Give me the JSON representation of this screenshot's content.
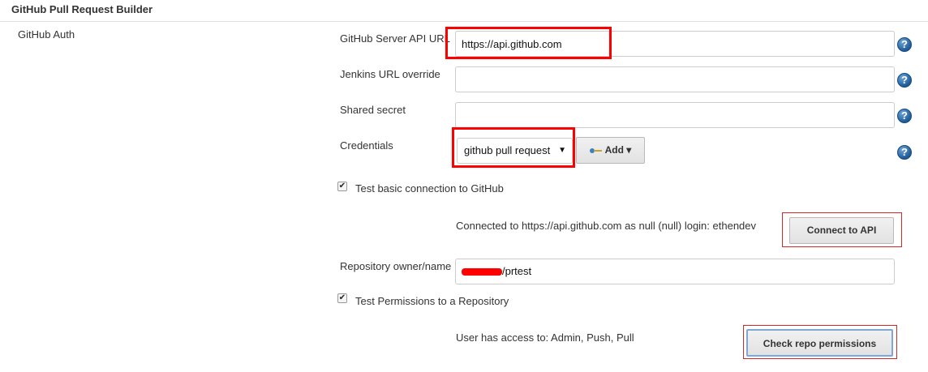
{
  "section": {
    "title": "GitHub Pull Request Builder"
  },
  "group": {
    "label": "GitHub Auth"
  },
  "fields": {
    "server_api_url": {
      "label": "GitHub Server API URL",
      "value": "https://api.github.com"
    },
    "jenkins_url_override": {
      "label": "Jenkins URL override",
      "value": ""
    },
    "shared_secret": {
      "label": "Shared secret",
      "value": ""
    },
    "credentials": {
      "label": "Credentials",
      "selected": "github pull request",
      "add_label": "Add"
    },
    "repo_owner_name": {
      "label": "Repository owner/name",
      "value": "/prtest"
    }
  },
  "test_connection": {
    "checkbox_label": "Test basic connection to GitHub",
    "checked": true,
    "result": "Connected to https://api.github.com as null (null) login: ethendev",
    "button_label": "Connect to API"
  },
  "test_permissions": {
    "checkbox_label": "Test Permissions to a Repository",
    "checked": true,
    "result": "User has access to: Admin, Push, Pull",
    "button_label": "Check repo permissions"
  },
  "icons": {
    "help": "?",
    "checkmark": "✔",
    "dropdown": "▼",
    "add_caret": "▾"
  },
  "colors": {
    "annotation_red": "#ff0000",
    "help_blue": "#1d5a96"
  }
}
